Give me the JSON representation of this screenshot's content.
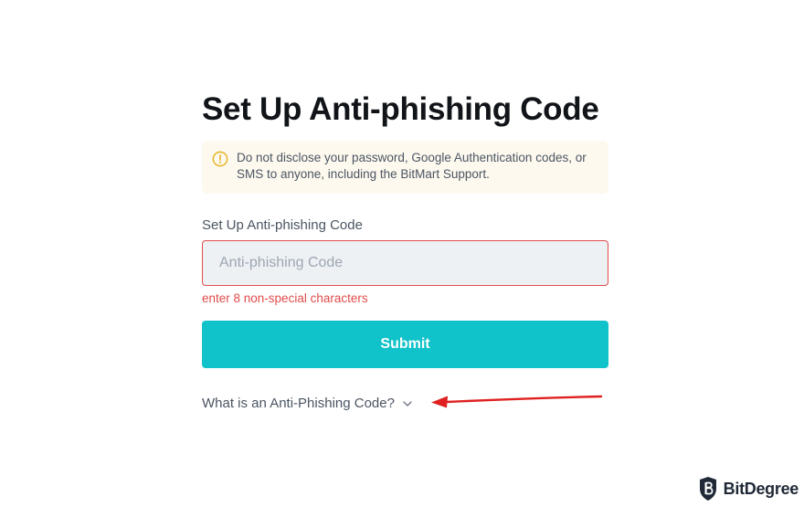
{
  "page": {
    "title": "Set Up Anti-phishing Code",
    "notice": {
      "icon": "warning-circle-icon",
      "text": "Do not disclose your password, Google Authentication codes, or SMS to anyone, including the BitMart Support."
    },
    "field": {
      "label": "Set Up Anti-phishing Code",
      "placeholder": "Anti-phishing Code",
      "value": "",
      "error": "enter 8 non-special characters"
    },
    "submit_label": "Submit",
    "faq_label": "What is an Anti-Phishing Code?"
  },
  "annotation": {
    "arrow_color": "#e02020"
  },
  "watermark": {
    "text": "BitDegree"
  },
  "colors": {
    "accent": "#10c2c9",
    "error": "#e04b4b",
    "notice_bg": "#fdf9ee",
    "warning": "#e5b320"
  }
}
